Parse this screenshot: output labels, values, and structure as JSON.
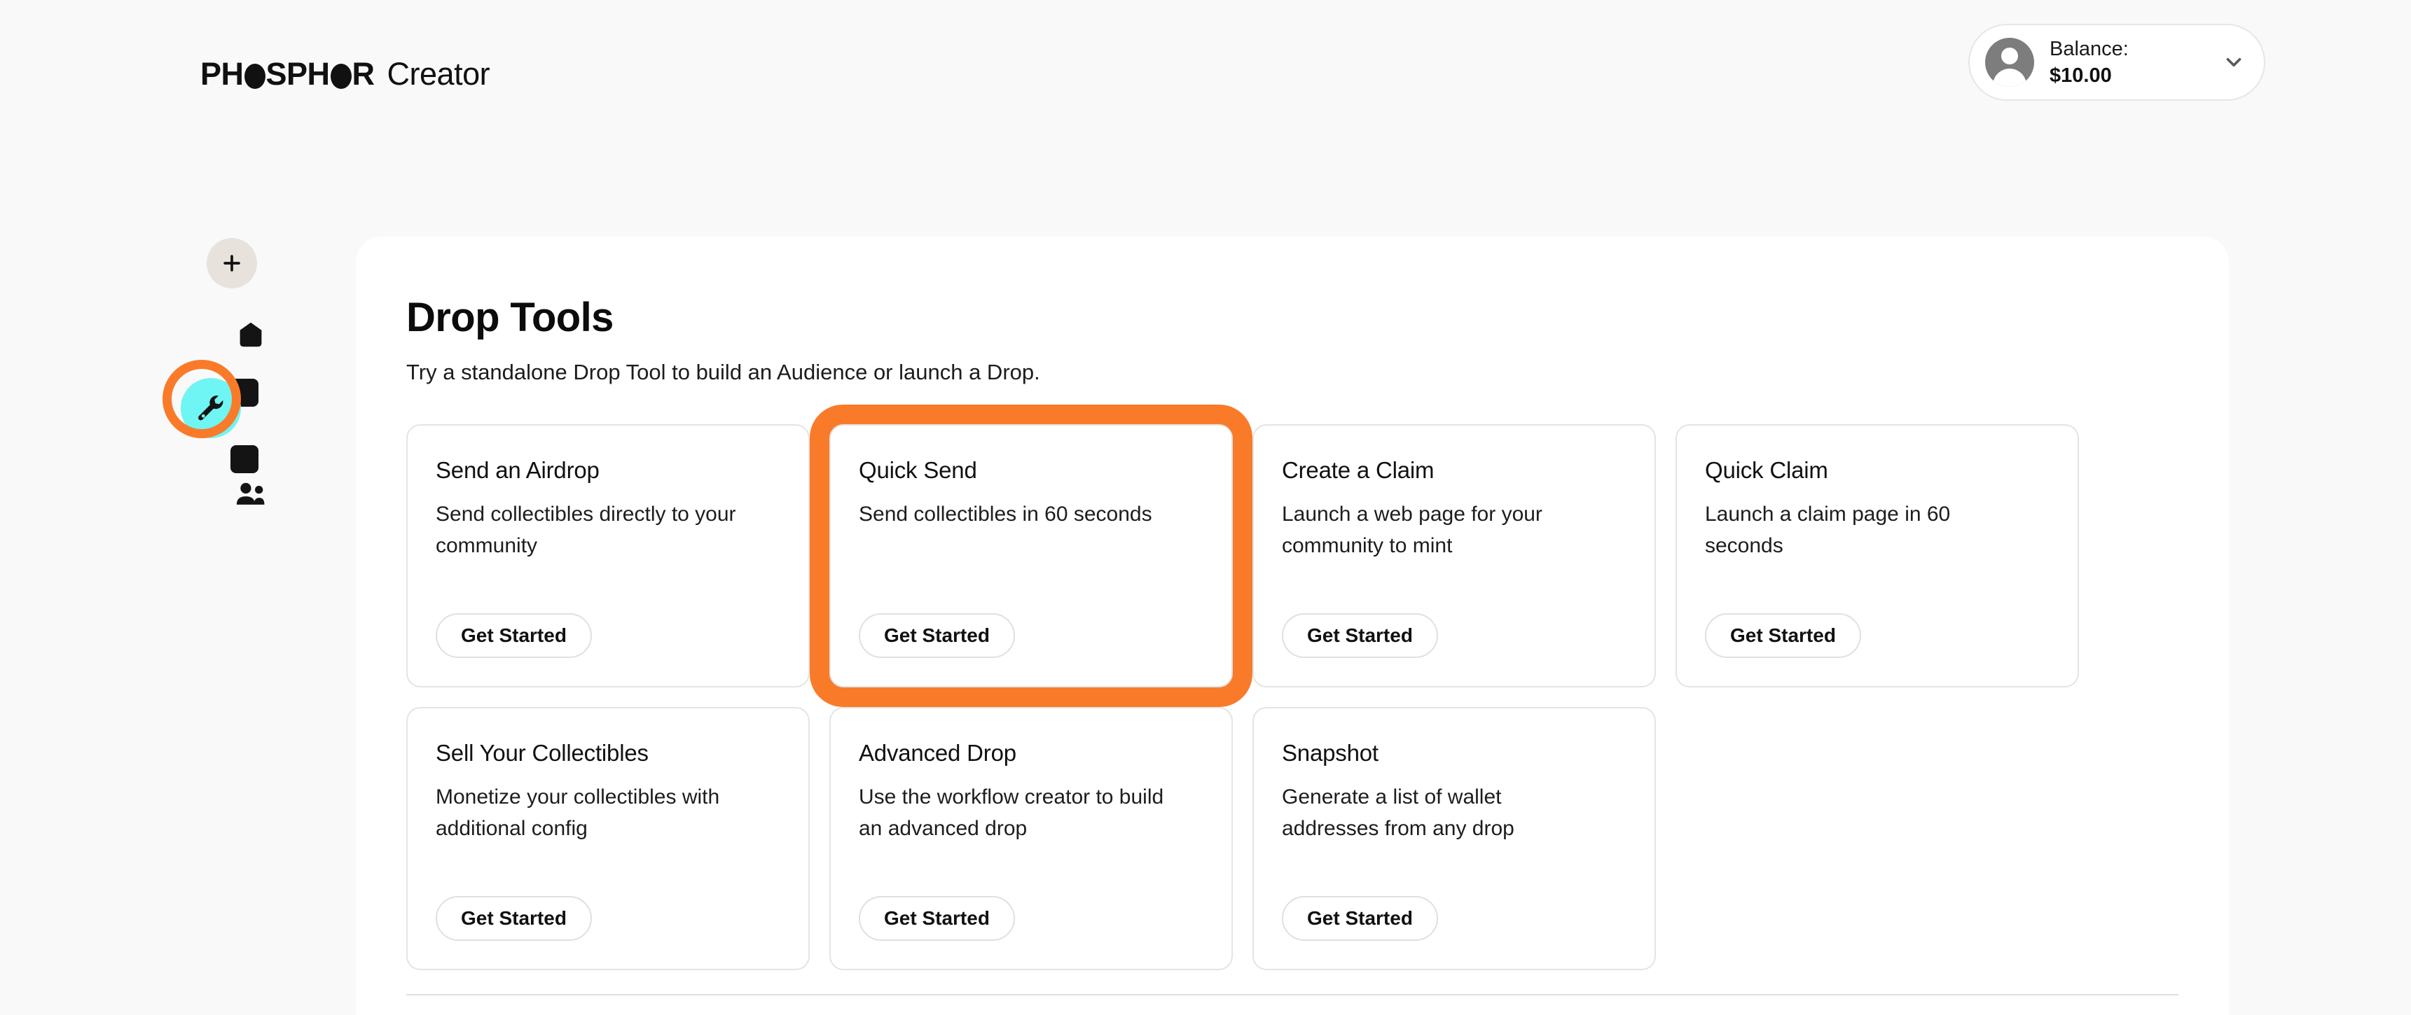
{
  "header": {
    "logo_mark_part1": "PH",
    "logo_mark_part2": "SPH",
    "logo_mark_part3": "R",
    "logo_full": "PHOSPHOR",
    "logo_sub": "Creator",
    "balance_label": "Balance:",
    "balance_value": "$10.00",
    "chevron_icon": "chevron-down-icon",
    "avatar_icon": "user-avatar-icon"
  },
  "sidebar": {
    "items": [
      {
        "name": "add-button",
        "icon": "plus-icon",
        "label": ""
      },
      {
        "name": "home",
        "icon": "pentagon-home-icon",
        "label": ""
      },
      {
        "name": "drop-tools",
        "icon": "wrench-icon",
        "label": "",
        "active": true
      },
      {
        "name": "audiences",
        "icon": "people-icon",
        "label": ""
      }
    ]
  },
  "main": {
    "title": "Drop Tools",
    "subtitle": "Try a standalone Drop Tool to build an Audience or launch a Drop.",
    "cards": [
      {
        "title": "Send an Airdrop",
        "description": "Send collectibles directly to your community",
        "button": "Get Started",
        "highlighted": false
      },
      {
        "title": "Quick Send",
        "description": "Send collectibles in 60 seconds",
        "button": "Get Started",
        "highlighted": true
      },
      {
        "title": "Create a Claim",
        "description": "Launch a web page for your community to mint",
        "button": "Get Started",
        "highlighted": false
      },
      {
        "title": "Quick Claim",
        "description": "Launch a claim page in 60 seconds",
        "button": "Get Started",
        "highlighted": false
      },
      {
        "title": "Sell Your Collectibles",
        "description": "Monetize your collectibles with additional config",
        "button": "Get Started",
        "highlighted": false
      },
      {
        "title": "Advanced Drop",
        "description": "Use the workflow creator to build an advanced drop",
        "button": "Get Started",
        "highlighted": false
      },
      {
        "title": "Snapshot",
        "description": "Generate a list of wallet addresses from any drop",
        "button": "Get Started",
        "highlighted": false
      }
    ]
  },
  "colors": {
    "highlight_orange": "#f97b2a",
    "active_cyan": "#6ff5f3",
    "add_button_beige": "#e8e2dd",
    "page_background": "#f9f9f9",
    "panel_background": "#ffffff",
    "avatar_gray": "#7d7d7d"
  }
}
